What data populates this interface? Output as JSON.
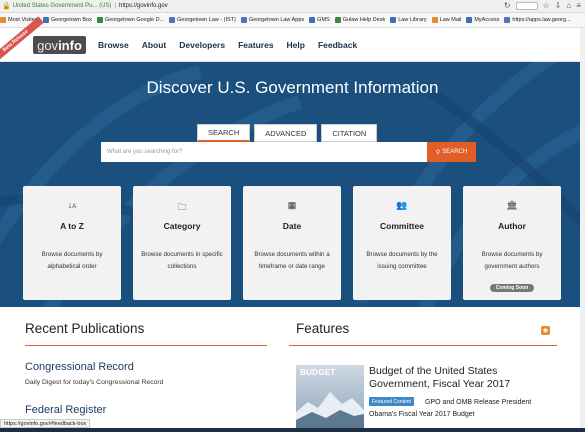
{
  "browser": {
    "site_identity": "United States Government Pu... (US)",
    "url": "https://govinfo.gov",
    "bookmarks": [
      "Most Visited",
      "Georgetown Box",
      "Georgetown Google D...",
      "Georgetown Law - (IST)",
      "Georgetown Law Apps",
      "GMS",
      "Gulaw Help Desk",
      "Law Library",
      "Law Mail",
      "MyAccess",
      "https://apps.law.georg..."
    ],
    "status_url": "https://govinfo.gov/#feedback-box"
  },
  "header": {
    "beta": "Beta Release",
    "logo_gov": "gov",
    "logo_info": "info",
    "nav": [
      "Browse",
      "About",
      "Developers",
      "Features",
      "Help",
      "Feedback"
    ]
  },
  "hero": {
    "title": "Discover U.S. Government Information",
    "tabs": [
      "SEARCH",
      "ADVANCED",
      "CITATION"
    ],
    "search_placeholder": "What are you searching for?",
    "search_button": "SEARCH"
  },
  "cards": [
    {
      "icon": "sort-az-icon",
      "title": "A to Z",
      "desc": "Browse documents by alphabetical order"
    },
    {
      "icon": "folder-icon",
      "title": "Category",
      "desc": "Browse documents in specific collections"
    },
    {
      "icon": "calendar-icon",
      "title": "Date",
      "desc": "Browse documents within a timeframe or date range"
    },
    {
      "icon": "group-icon",
      "title": "Committee",
      "desc": "Browse documents by the issuing committee"
    },
    {
      "icon": "building-icon",
      "title": "Author",
      "desc": "Browse documents by government authors",
      "badge": "Coming Soon"
    }
  ],
  "recent": {
    "title": "Recent Publications",
    "items": [
      {
        "title": "Congressional Record",
        "desc": "Daily Digest for today's Congressional Record"
      },
      {
        "title": "Federal Register"
      }
    ]
  },
  "features": {
    "title": "Features",
    "image_text": "BUDGET",
    "headline": "Budget of the United States Government, Fiscal Year 2017",
    "badge": "Featured Content",
    "text": "GPO and OMB Release President Obama's Fiscal Year 2017 Budget"
  },
  "colors": {
    "accent": "#e35d29",
    "hero_bg": "#1b4f7e",
    "link": "#1c3c64"
  }
}
